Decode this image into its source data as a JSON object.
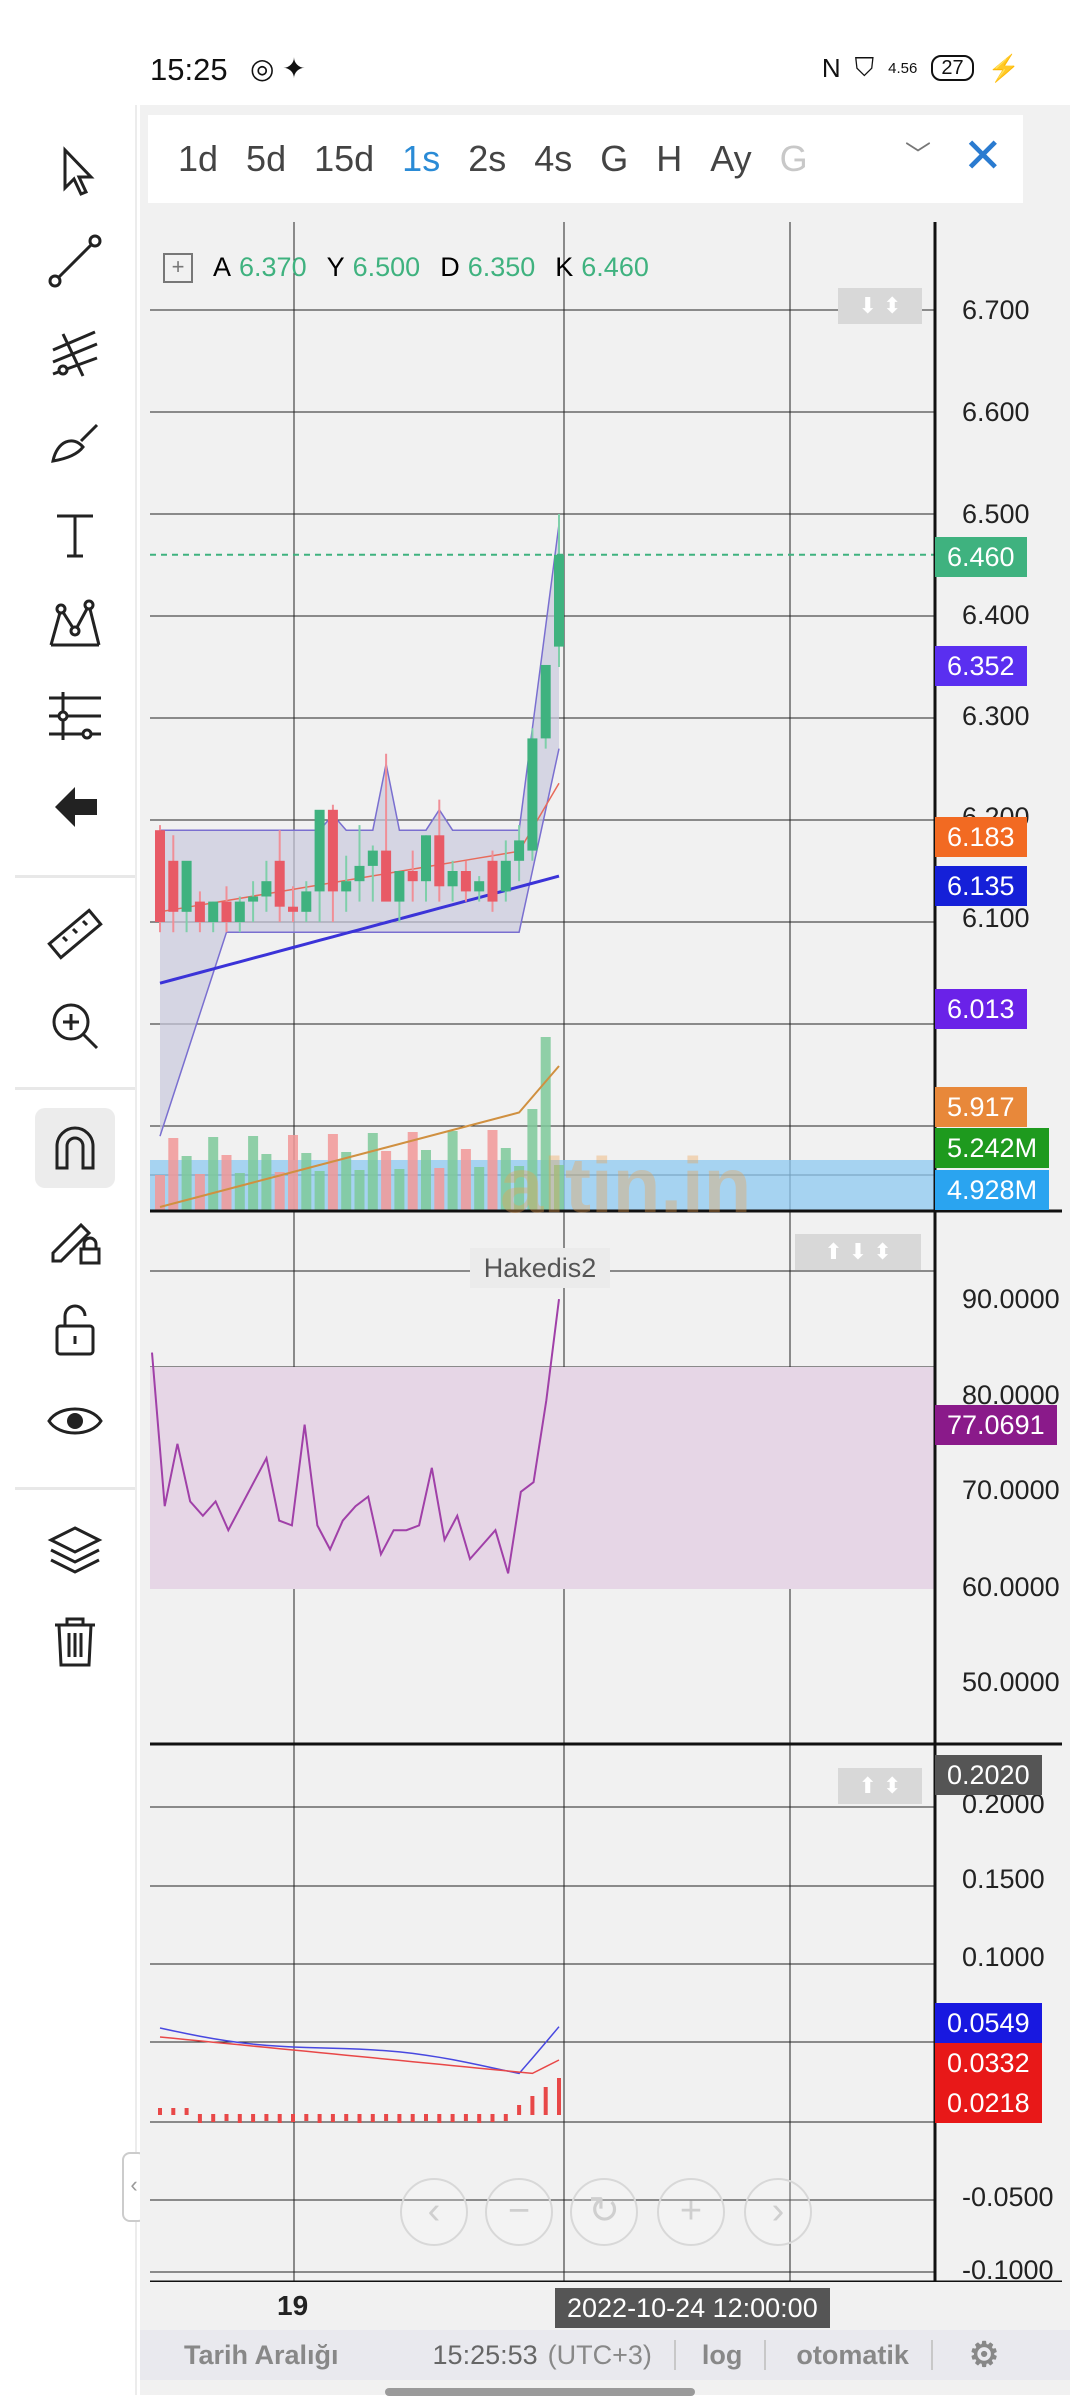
{
  "status": {
    "time": "15:25",
    "app_icons": "◎ ✦",
    "battery": "27",
    "signal_text": "4.56"
  },
  "timeframes": [
    {
      "label": "1d",
      "active": false
    },
    {
      "label": "5d",
      "active": false
    },
    {
      "label": "15d",
      "active": false
    },
    {
      "label": "1s",
      "active": true
    },
    {
      "label": "2s",
      "active": false
    },
    {
      "label": "4s",
      "active": false
    },
    {
      "label": "G",
      "active": false
    },
    {
      "label": "H",
      "active": false
    },
    {
      "label": "Ay",
      "active": false
    },
    {
      "label": "G",
      "active": false,
      "dim": true
    }
  ],
  "ohlc": {
    "a_label": "A",
    "a": "6.370",
    "y_label": "Y",
    "y": "6.500",
    "d_label": "D",
    "d": "6.350",
    "k_label": "K",
    "k": "6.460"
  },
  "price_axis": [
    "6.700",
    "6.600",
    "6.500",
    "6.400",
    "6.300",
    "6.200",
    "6.100",
    "6.000"
  ],
  "price_labels": [
    {
      "text": "6.460",
      "color": "#3fb27f"
    },
    {
      "text": "6.352",
      "color": "#5a2ff0"
    },
    {
      "text": "6.183",
      "color": "#f26a22"
    },
    {
      "text": "6.135",
      "color": "#1520d8"
    },
    {
      "text": "6.013",
      "color": "#6a22e8"
    },
    {
      "text": "5.917",
      "color": "#e8883a"
    },
    {
      "text": "5.242M",
      "color": "#1e9a1e"
    },
    {
      "text": "4.928M",
      "color": "#2aa4f0"
    }
  ],
  "watermark": "altin.in",
  "rsi": {
    "title": "Hakedis2",
    "axis": [
      "90.0000",
      "80.0000",
      "70.0000",
      "60.0000",
      "50.0000"
    ],
    "current": "77.0691",
    "current_color": "#8a1a8a"
  },
  "macd": {
    "axis": [
      "0.2000",
      "0.1500",
      "0.1000",
      "-0.0500",
      "-0.1000"
    ],
    "labels": [
      {
        "text": "0.2020",
        "color": "#555555"
      },
      {
        "text": "0.0549",
        "color": "#1818e0"
      },
      {
        "text": "0.0332",
        "color": "#e81818"
      },
      {
        "text": "0.0218",
        "color": "#e81818"
      }
    ]
  },
  "time_axis": {
    "tick": "19",
    "tooltip": "2022-10-24 12:00:00"
  },
  "bottom": {
    "range": "Tarih Aralığı",
    "clock": "15:25:53",
    "tz": "(UTC+3)",
    "log": "log",
    "auto": "otomatik"
  },
  "chart_data": {
    "type": "candlestick",
    "ohlc_last": {
      "open": 6.37,
      "high": 6.5,
      "low": 6.35,
      "close": 6.46
    },
    "candles": [
      {
        "o": 6.19,
        "h": 6.195,
        "l": 6.09,
        "c": 6.1
      },
      {
        "o": 6.16,
        "h": 6.185,
        "l": 6.09,
        "c": 6.11
      },
      {
        "o": 6.11,
        "h": 6.15,
        "l": 6.09,
        "c": 6.16
      },
      {
        "o": 6.12,
        "h": 6.13,
        "l": 6.09,
        "c": 6.1
      },
      {
        "o": 6.1,
        "h": 6.12,
        "l": 6.09,
        "c": 6.12
      },
      {
        "o": 6.12,
        "h": 6.135,
        "l": 6.09,
        "c": 6.1
      },
      {
        "o": 6.1,
        "h": 6.125,
        "l": 6.09,
        "c": 6.12
      },
      {
        "o": 6.12,
        "h": 6.14,
        "l": 6.1,
        "c": 6.125
      },
      {
        "o": 6.125,
        "h": 6.16,
        "l": 6.11,
        "c": 6.14
      },
      {
        "o": 6.16,
        "h": 6.19,
        "l": 6.1,
        "c": 6.115
      },
      {
        "o": 6.115,
        "h": 6.135,
        "l": 6.1,
        "c": 6.11
      },
      {
        "o": 6.11,
        "h": 6.14,
        "l": 6.1,
        "c": 6.13
      },
      {
        "o": 6.13,
        "h": 6.175,
        "l": 6.1,
        "c": 6.21
      },
      {
        "o": 6.21,
        "h": 6.215,
        "l": 6.1,
        "c": 6.13
      },
      {
        "o": 6.13,
        "h": 6.165,
        "l": 6.11,
        "c": 6.14
      },
      {
        "o": 6.14,
        "h": 6.195,
        "l": 6.12,
        "c": 6.155
      },
      {
        "o": 6.155,
        "h": 6.175,
        "l": 6.12,
        "c": 6.17
      },
      {
        "o": 6.17,
        "h": 6.265,
        "l": 6.13,
        "c": 6.12
      },
      {
        "o": 6.12,
        "h": 6.15,
        "l": 6.1,
        "c": 6.15
      },
      {
        "o": 6.15,
        "h": 6.17,
        "l": 6.12,
        "c": 6.14
      },
      {
        "o": 6.14,
        "h": 6.185,
        "l": 6.12,
        "c": 6.185
      },
      {
        "o": 6.185,
        "h": 6.22,
        "l": 6.12,
        "c": 6.135
      },
      {
        "o": 6.135,
        "h": 6.16,
        "l": 6.12,
        "c": 6.15
      },
      {
        "o": 6.15,
        "h": 6.16,
        "l": 6.12,
        "c": 6.13
      },
      {
        "o": 6.13,
        "h": 6.145,
        "l": 6.12,
        "c": 6.14
      },
      {
        "o": 6.16,
        "h": 6.17,
        "l": 6.11,
        "c": 6.12
      },
      {
        "o": 6.13,
        "h": 6.18,
        "l": 6.12,
        "c": 6.16
      },
      {
        "o": 6.16,
        "h": 6.195,
        "l": 6.14,
        "c": 6.18
      },
      {
        "o": 6.17,
        "h": 6.29,
        "l": 6.16,
        "c": 6.28
      },
      {
        "o": 6.28,
        "h": 6.35,
        "l": 6.27,
        "c": 6.352
      },
      {
        "o": 6.37,
        "h": 6.5,
        "l": 6.35,
        "c": 6.46
      }
    ],
    "rsi_values": [
      71.5,
      55.5,
      62,
      56,
      54.5,
      56,
      53,
      55.5,
      58,
      60.5,
      54,
      53.5,
      64,
      53.5,
      51,
      54,
      55.5,
      56.5,
      50.5,
      53,
      53,
      53.5,
      59.5,
      52,
      54.5,
      50,
      51.5,
      53,
      48.5,
      57,
      58,
      66.5,
      77.0691
    ],
    "rsi_band": [
      50,
      70
    ],
    "macd_last": {
      "macd": 0.0549,
      "signal": 0.0332,
      "histogram": 0.0218
    }
  }
}
